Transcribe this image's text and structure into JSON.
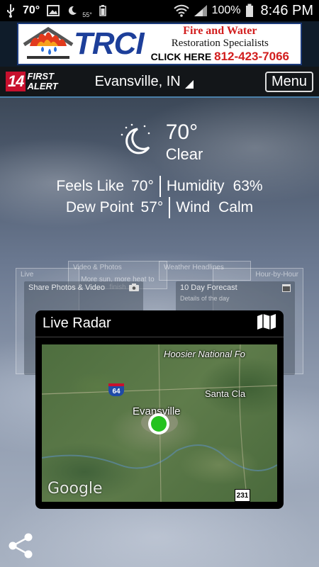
{
  "status_bar": {
    "temp": "70°",
    "small_temp": "55°",
    "battery": "100%",
    "time": "8:46 PM",
    "icons": [
      "usb-icon",
      "image-icon",
      "weather-night-icon",
      "battery-small-icon",
      "wifi-icon",
      "signal-icon",
      "battery-icon"
    ]
  },
  "ad": {
    "brand": "TRCI",
    "line1": "Fire and Water",
    "line2": "Restoration Specialists",
    "line3_prefix": "CLICK HERE",
    "phone": "812-423-7066"
  },
  "app_bar": {
    "logo_number": "14",
    "logo_line1": "FIRST",
    "logo_line2": "ALERT",
    "location": "Evansville, IN",
    "menu_label": "Menu"
  },
  "current": {
    "temperature": "70°",
    "condition": "Clear",
    "icon": "moon-stars-icon",
    "feels_like_label": "Feels Like",
    "feels_like_value": "70°",
    "humidity_label": "Humidity",
    "humidity_value": "63%",
    "dew_point_label": "Dew Point",
    "dew_point_value": "57°",
    "wind_label": "Wind",
    "wind_value": "Calm"
  },
  "background_cards": {
    "live": "Live",
    "video_photos": "Video & Photos",
    "more_heat": "More sun, more heat to finish",
    "weather_headlines": "Weather Headlines",
    "hour_by_hour": "Hour-by-Hour",
    "share_photos": "Share Photos & Video",
    "ten_day": "10 Day Forecast",
    "details": "Details of the day"
  },
  "radar": {
    "title": "Live Radar",
    "map_labels": {
      "hoosier": "Hoosier National Fo",
      "santa_claus": "Santa Cla",
      "evansville": "Evansville",
      "interstate": "64",
      "us_route": "231",
      "google": "Google"
    }
  },
  "colors": {
    "app_bar_border": "#4a7fa8",
    "brand_red": "#c8102e",
    "pin_green": "#25c21f"
  }
}
